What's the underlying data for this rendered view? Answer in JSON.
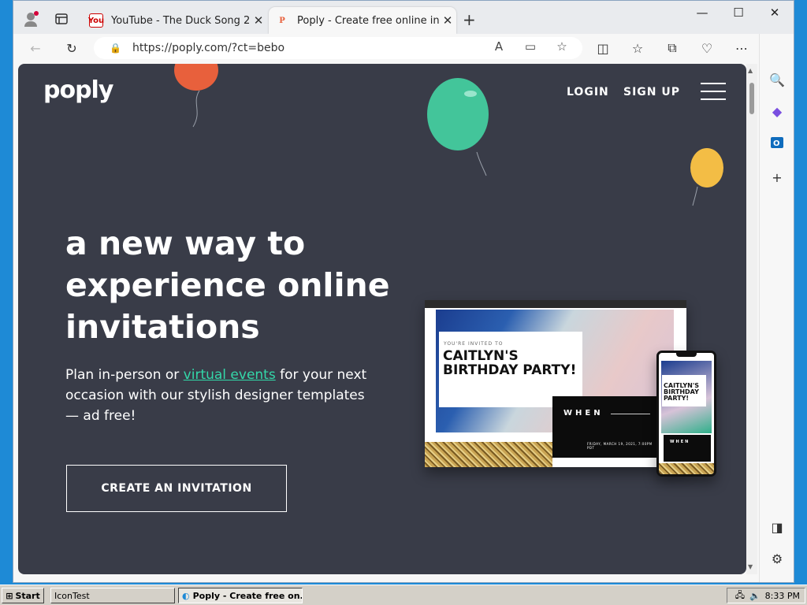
{
  "browser": {
    "tabs": [
      {
        "title": "YouTube - The Duck Song 2",
        "favicon": "youtube-icon"
      },
      {
        "title": "Poply - Create free online invitat",
        "favicon": "poply-icon"
      }
    ],
    "url": "https://poply.com/?ct=bebo"
  },
  "site": {
    "logo": "poply",
    "nav": {
      "login": "LOGIN",
      "signup": "SIGN UP"
    },
    "headline": "a new way to experience online invitations",
    "sub_before": "Plan in-person or ",
    "sub_link": "virtual events",
    "sub_after": " for your next occasion with our stylish designer templates — ad free!",
    "cta": "CREATE AN INVITATION",
    "mock": {
      "pre": "YOU'RE INVITED TO",
      "name": "CAITLYN'S BIRTHDAY PARTY!",
      "when": "WHEN",
      "date": "FRIDAY, MARCH 19, 2021, 7:00PM PDT"
    },
    "colors": {
      "background": "#393c48",
      "accent": "#33d8a9"
    }
  },
  "taskbar": {
    "start": "Start",
    "tasks": [
      "IconTest",
      "Poply - Create free on..."
    ],
    "clock": "8:33 PM"
  }
}
